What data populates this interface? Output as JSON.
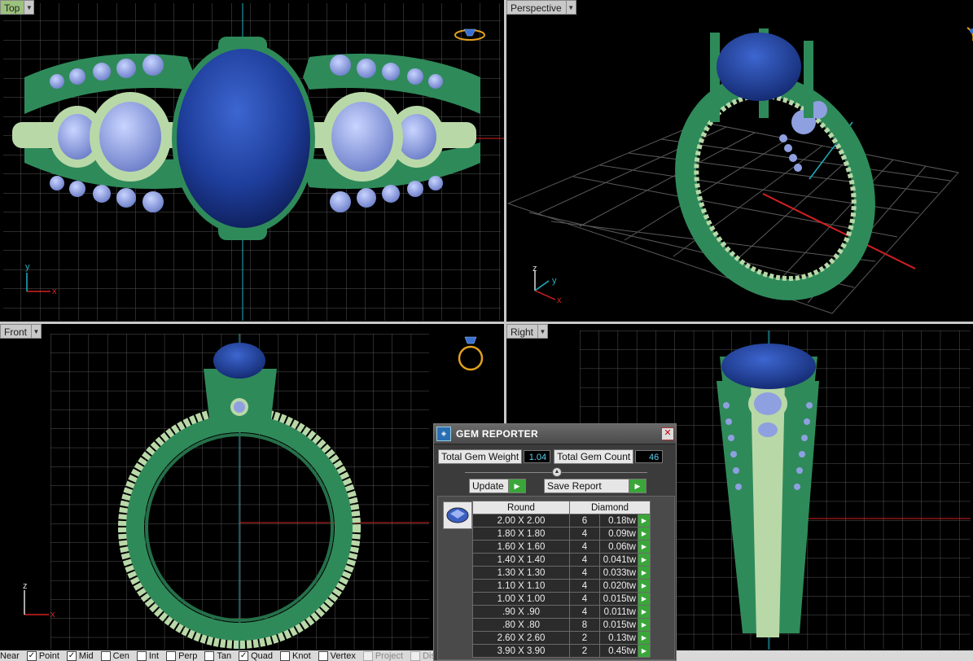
{
  "viewports": {
    "top": {
      "label": "Top"
    },
    "perspective": {
      "label": "Perspective"
    },
    "front": {
      "label": "Front"
    },
    "right": {
      "label": "Right"
    }
  },
  "axis_labels": {
    "x": "x",
    "y": "y",
    "z": "z"
  },
  "gem_reporter": {
    "title": "GEM REPORTER",
    "total_weight_label": "Total Gem Weight",
    "total_weight_value": "1.04",
    "total_count_label": "Total Gem Count",
    "total_count_value": "46",
    "update_label": "Update",
    "save_report_label": "Save Report",
    "col_shape": "Round",
    "col_material": "Diamond",
    "rows": [
      {
        "size": "2.00 X 2.00",
        "count": "6",
        "weight": "0.18tw"
      },
      {
        "size": "1.80 X 1.80",
        "count": "4",
        "weight": "0.09tw"
      },
      {
        "size": "1.60 X 1.60",
        "count": "4",
        "weight": "0.06tw"
      },
      {
        "size": "1.40 X 1.40",
        "count": "4",
        "weight": "0.041tw"
      },
      {
        "size": "1.30 X 1.30",
        "count": "4",
        "weight": "0.033tw"
      },
      {
        "size": "1.10 X 1.10",
        "count": "4",
        "weight": "0.020tw"
      },
      {
        "size": "1.00 X 1.00",
        "count": "4",
        "weight": "0.015tw"
      },
      {
        "size": ".90 X .90",
        "count": "4",
        "weight": "0.011tw"
      },
      {
        "size": ".80 X .80",
        "count": "8",
        "weight": "0.015tw"
      },
      {
        "size": "2.60 X 2.60",
        "count": "2",
        "weight": "0.13tw"
      },
      {
        "size": "3.90 X 3.90",
        "count": "2",
        "weight": "0.45tw"
      }
    ]
  },
  "osnap": [
    {
      "label": "Near",
      "checked": false,
      "enabled": true,
      "nobox": true
    },
    {
      "label": "Point",
      "checked": true,
      "enabled": true
    },
    {
      "label": "Mid",
      "checked": true,
      "enabled": true
    },
    {
      "label": "Cen",
      "checked": false,
      "enabled": true
    },
    {
      "label": "Int",
      "checked": false,
      "enabled": true
    },
    {
      "label": "Perp",
      "checked": false,
      "enabled": true
    },
    {
      "label": "Tan",
      "checked": false,
      "enabled": true
    },
    {
      "label": "Quad",
      "checked": true,
      "enabled": true
    },
    {
      "label": "Knot",
      "checked": false,
      "enabled": true
    },
    {
      "label": "Vertex",
      "checked": false,
      "enabled": true
    },
    {
      "label": "Project",
      "checked": false,
      "enabled": false
    },
    {
      "label": "Dis",
      "checked": false,
      "enabled": false
    }
  ],
  "colors": {
    "metal_green": "#2f8a5a",
    "metal_light": "#b9d8a8",
    "sapphire": "#1e3d9a",
    "small_gem": "#8fa0e0",
    "grid": "#5a5a5a",
    "axis_x": "#d42020",
    "axis_y": "#20b0c0"
  },
  "icons": [
    "ring-preview-icon",
    "gem-reporter-logo-icon",
    "close-icon",
    "round-gem-icon",
    "go-arrow-icon"
  ]
}
